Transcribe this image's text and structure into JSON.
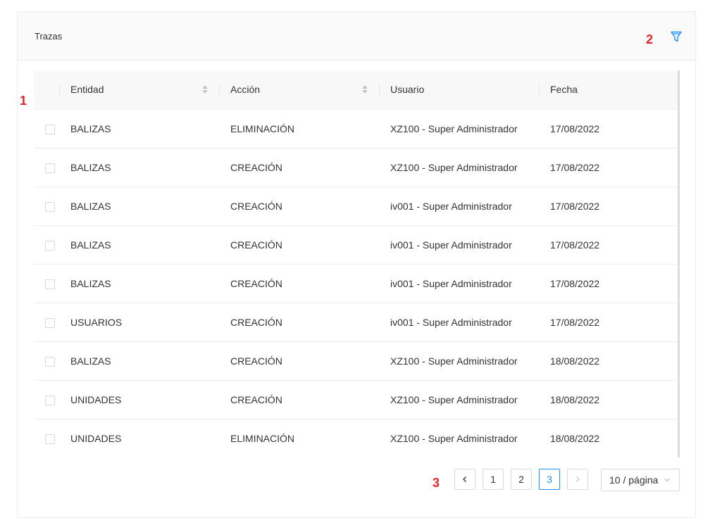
{
  "header": {
    "title": "Trazas",
    "filter_icon": "filter-icon"
  },
  "markers": [
    "1",
    "2",
    "3"
  ],
  "table": {
    "columns": [
      "Entidad",
      "Acción",
      "Usuario",
      "Fecha"
    ],
    "rows": [
      [
        "BALIZAS",
        "ELIMINACIÓN",
        "XZ100 - Super Administrador",
        "17/08/2022"
      ],
      [
        "BALIZAS",
        "CREACIÓN",
        "XZ100 - Super Administrador",
        "17/08/2022"
      ],
      [
        "BALIZAS",
        "CREACIÓN",
        "iv001 - Super Administrador",
        "17/08/2022"
      ],
      [
        "BALIZAS",
        "CREACIÓN",
        "iv001 - Super Administrador",
        "17/08/2022"
      ],
      [
        "BALIZAS",
        "CREACIÓN",
        "iv001 - Super Administrador",
        "17/08/2022"
      ],
      [
        "USUARIOS",
        "CREACIÓN",
        "iv001 - Super Administrador",
        "17/08/2022"
      ],
      [
        "BALIZAS",
        "CREACIÓN",
        "XZ100 - Super Administrador",
        "18/08/2022"
      ],
      [
        "UNIDADES",
        "CREACIÓN",
        "XZ100 - Super Administrador",
        "18/08/2022"
      ],
      [
        "UNIDADES",
        "ELIMINACIÓN",
        "XZ100 - Super Administrador",
        "18/08/2022"
      ]
    ]
  },
  "pagination": {
    "pages": [
      "1",
      "2",
      "3"
    ],
    "current": "3",
    "page_size": "10 / página",
    "prev_icon": "chevron-left-icon",
    "next_icon": "chevron-right-icon"
  },
  "colors": {
    "accent": "#1890ff",
    "marker": "#e3242b"
  }
}
